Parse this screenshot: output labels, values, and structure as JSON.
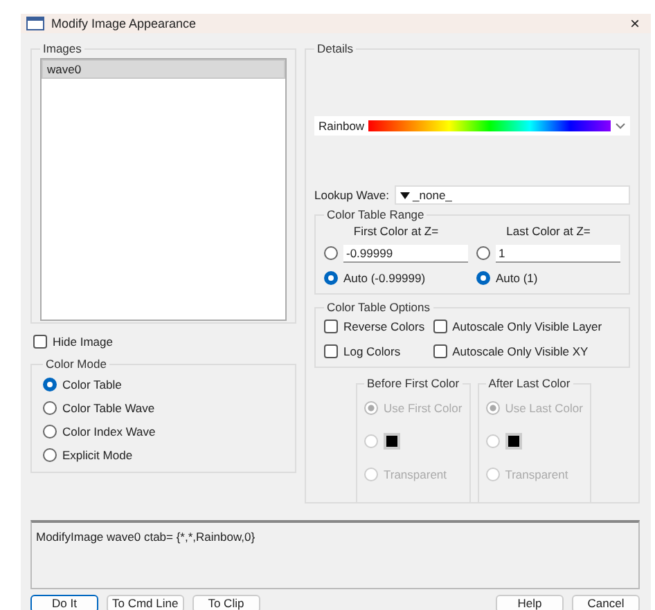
{
  "window": {
    "title": "Modify Image Appearance",
    "close": "×"
  },
  "images": {
    "label": "Images",
    "items": [
      {
        "name": "wave0",
        "selected": true
      }
    ]
  },
  "hide_image": {
    "label": "Hide Image",
    "checked": false
  },
  "color_mode": {
    "label": "Color Mode",
    "options": [
      {
        "label": "Color Table",
        "selected": true
      },
      {
        "label": "Color Table Wave",
        "selected": false
      },
      {
        "label": "Color Index Wave",
        "selected": false
      },
      {
        "label": "Explicit Mode",
        "selected": false
      }
    ]
  },
  "details": {
    "label": "Details",
    "color_table": {
      "value": "Rainbow"
    },
    "lookup_wave": {
      "label": "Lookup Wave:",
      "value": "_none_"
    },
    "range": {
      "label": "Color Table Range",
      "columns": [
        {
          "heading": "First Color at Z=",
          "value": "-0.99999",
          "manual_selected": false,
          "auto_label": "Auto (-0.99999)",
          "auto_selected": true
        },
        {
          "heading": "Last Color at Z=",
          "value": "1",
          "manual_selected": false,
          "auto_label": "Auto (1)",
          "auto_selected": true
        }
      ]
    },
    "options": {
      "label": "Color Table Options",
      "checkboxes": [
        {
          "label": "Reverse Colors",
          "checked": false
        },
        {
          "label": "Autoscale Only Visible Layer",
          "checked": false
        },
        {
          "label": "Log Colors",
          "checked": false
        },
        {
          "label": "Autoscale Only Visible XY",
          "checked": false
        }
      ]
    },
    "out_of_range": {
      "disabled": true,
      "groups": [
        {
          "label": "Before First Color",
          "options": [
            {
              "kind": "radio",
              "label": "Use First Color",
              "selected": true
            },
            {
              "kind": "swatch",
              "selected": false
            },
            {
              "kind": "radio",
              "label": "Transparent",
              "selected": false
            }
          ]
        },
        {
          "label": "After Last Color",
          "options": [
            {
              "kind": "radio",
              "label": "Use Last Color",
              "selected": true
            },
            {
              "kind": "swatch",
              "selected": false
            },
            {
              "kind": "radio",
              "label": "Transparent",
              "selected": false
            }
          ]
        }
      ]
    }
  },
  "command": {
    "text": "ModifyImage wave0 ctab= {*,*,Rainbow,0}"
  },
  "left_buttons": [
    {
      "label": "Do It",
      "default": true
    },
    {
      "label": "To Cmd Line",
      "default": false
    },
    {
      "label": "To Clip",
      "default": false
    }
  ],
  "right_buttons": [
    {
      "label": "Help",
      "default": false
    },
    {
      "label": "Cancel",
      "default": false
    }
  ]
}
